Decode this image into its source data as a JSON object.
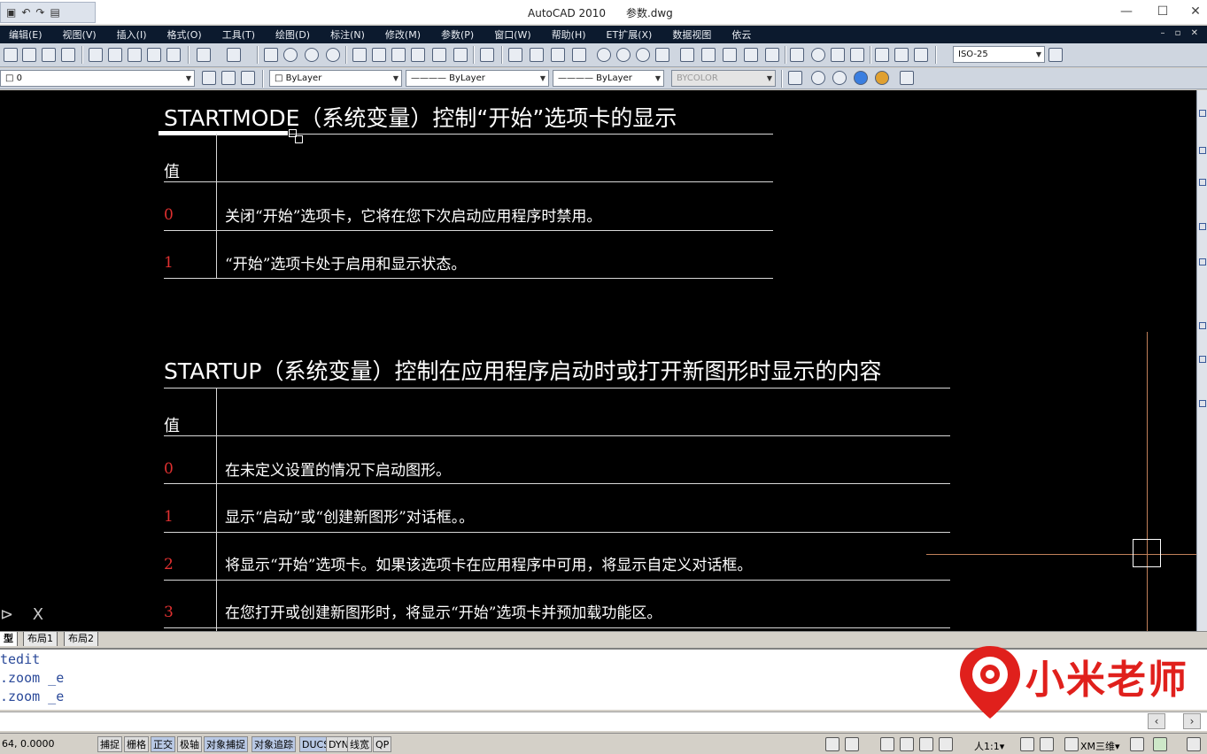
{
  "window": {
    "app_title": "AutoCAD 2010",
    "file_name": "参数.dwg",
    "minimize_glyph": "—",
    "maximize_glyph": "☐",
    "close_glyph": "✕",
    "qat_glyphs": [
      "▣",
      "↶",
      "↷",
      "▤"
    ]
  },
  "menu": {
    "items": [
      "编辑(E)",
      "视图(V)",
      "插入(I)",
      "格式(O)",
      "工具(T)",
      "绘图(D)",
      "标注(N)",
      "修改(M)",
      "参数(P)",
      "窗口(W)",
      "帮助(H)",
      "ET扩展(X)",
      "数据视图",
      "依云"
    ],
    "mdi_controls": "– ▫ ✕"
  },
  "toolbar": {
    "dimstyle_value": "ISO-25",
    "layer_value": "0",
    "color_value": "ByLayer",
    "linetype_value": "———— ByLayer",
    "lineweight_value": "———— ByLayer",
    "plotstyle_value": "BYCOLOR"
  },
  "drawing": {
    "startmode": {
      "title": "STARTMODE（系统变量）控制“开始”选项卡的显示",
      "value_header": "值",
      "rows": [
        {
          "value": "0",
          "desc": "关闭“开始”选项卡，它将在您下次启动应用程序时禁用。"
        },
        {
          "value": "1",
          "desc": "“开始”选项卡处于启用和显示状态。"
        }
      ]
    },
    "startup": {
      "title": "STARTUP（系统变量）控制在应用程序启动时或打开新图形时显示的内容",
      "value_header": "值",
      "rows": [
        {
          "value": "0",
          "desc": "在未定义设置的情况下启动图形。"
        },
        {
          "value": "1",
          "desc": "显示“启动”或“创建新图形”对话框。。"
        },
        {
          "value": "2",
          "desc": "将显示“开始”选项卡。如果该选项卡在应用程序中可用，将显示自定义对话框。"
        },
        {
          "value": "3",
          "desc": "在您打开或创建新图形时，将显示“开始”选项卡并预加载功能区。"
        }
      ]
    },
    "ucs_icon": "⊳ X"
  },
  "layout_tabs": [
    "型",
    "布局1",
    "布局2"
  ],
  "command": {
    "lines": [
      "tedit",
      ".zoom _e",
      ".zoom _e"
    ]
  },
  "watermark": {
    "text": "小米老师",
    "brand_color": "#e0201c"
  },
  "status": {
    "coords": "64, 0.0000",
    "toggles": [
      "捕捉",
      "栅格",
      "正交",
      "极轴",
      "对象捕捉",
      "对象追踪",
      "DUCS",
      "DYN",
      "线宽",
      "QP"
    ],
    "annotation_scale": "人1:1▾",
    "workspace": "XM三维▾"
  }
}
